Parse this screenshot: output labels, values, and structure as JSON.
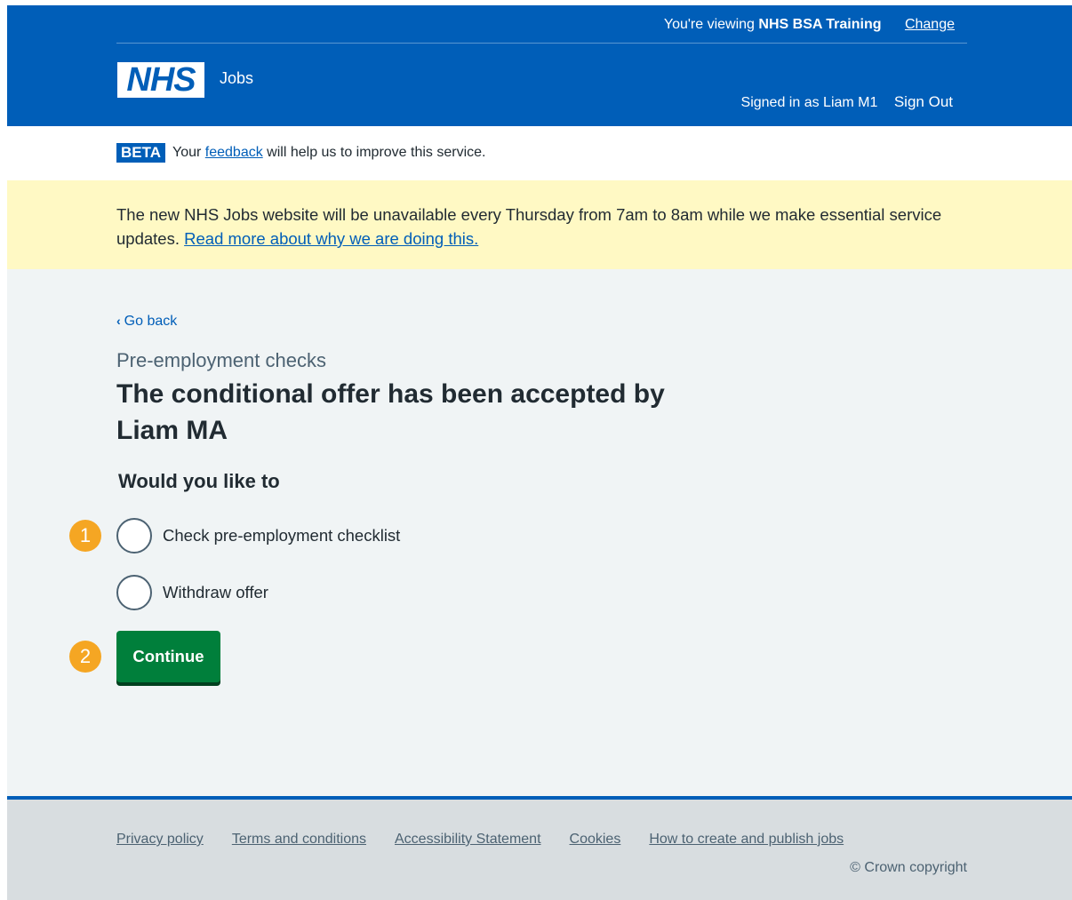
{
  "header": {
    "viewing_prefix": "You're viewing",
    "organisation": "NHS BSA Training",
    "change_label": "Change",
    "logo_text": "NHS",
    "service_name": "Jobs",
    "signed_in_text": "Signed in as Liam M1",
    "sign_out_label": "Sign Out"
  },
  "beta": {
    "tag": "BETA",
    "text_before": "Your",
    "feedback_link": "feedback",
    "text_after": "will help us to improve this service."
  },
  "banner": {
    "text": "The new NHS Jobs website will be unavailable every Thursday from 7am to 8am while we make essential service updates.",
    "link": "Read more about why we are doing this."
  },
  "main": {
    "back_label": "Go back",
    "caption": "Pre-employment checks",
    "title": "The conditional offer has been accepted by Liam MA",
    "legend": "Would you like to",
    "options": [
      {
        "label": "Check pre-employment checklist"
      },
      {
        "label": "Withdraw offer"
      }
    ],
    "continue_label": "Continue",
    "callouts": [
      "1",
      "2"
    ]
  },
  "footer": {
    "links": [
      "Privacy policy",
      "Terms and conditions",
      "Accessibility Statement",
      "Cookies",
      "How to create and publish jobs"
    ],
    "copyright": "© Crown copyright"
  },
  "colors": {
    "nhs_blue": "#005eb8",
    "banner_yellow": "#fff9c4",
    "button_green": "#007f3b",
    "callout_orange": "#f5a623",
    "page_background": "#f0f4f5"
  }
}
